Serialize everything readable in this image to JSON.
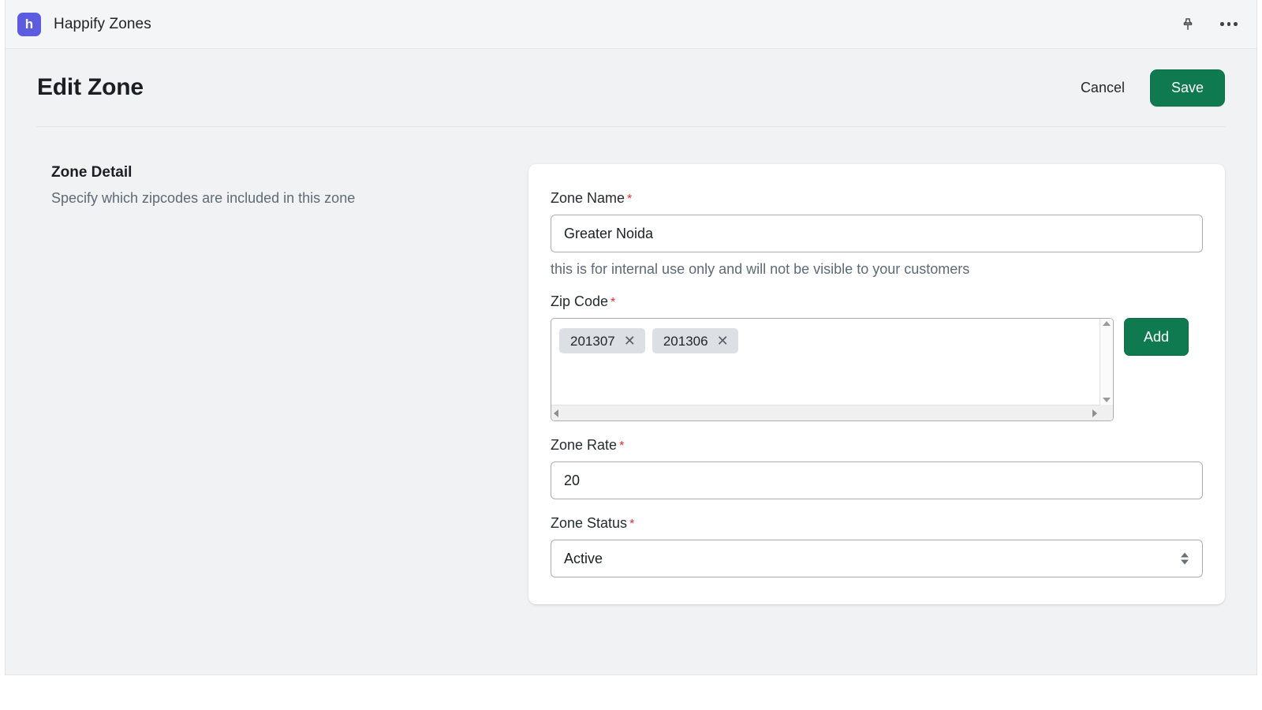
{
  "topbar": {
    "logo_letter": "h",
    "app_title": "Happify Zones",
    "pin_icon": "pin-icon",
    "more_icon": "more-horizontal-icon"
  },
  "page_header": {
    "title": "Edit Zone",
    "cancel_label": "Cancel",
    "save_label": "Save"
  },
  "section": {
    "title": "Zone Detail",
    "subtitle": "Specify which zipcodes are included in this zone"
  },
  "form": {
    "zone_name": {
      "label": "Zone Name",
      "required_marker": "*",
      "value": "Greater Noida",
      "helper": "this is for internal use only and will not be visible to your customers"
    },
    "zip_code": {
      "label": "Zip Code",
      "required_marker": "*",
      "tags": [
        {
          "value": "201307",
          "remove_icon": "✕"
        },
        {
          "value": "201306",
          "remove_icon": "✕"
        }
      ],
      "add_label": "Add"
    },
    "zone_rate": {
      "label": "Zone Rate",
      "required_marker": "*",
      "value": "20"
    },
    "zone_status": {
      "label": "Zone Status",
      "required_marker": "*",
      "value": "Active",
      "options": [
        "Active"
      ]
    }
  },
  "colors": {
    "accent_green": "#0f7a50",
    "logo_purple": "#5c5ce0",
    "required_red": "#e03030",
    "page_bg": "#f1f2f4"
  }
}
